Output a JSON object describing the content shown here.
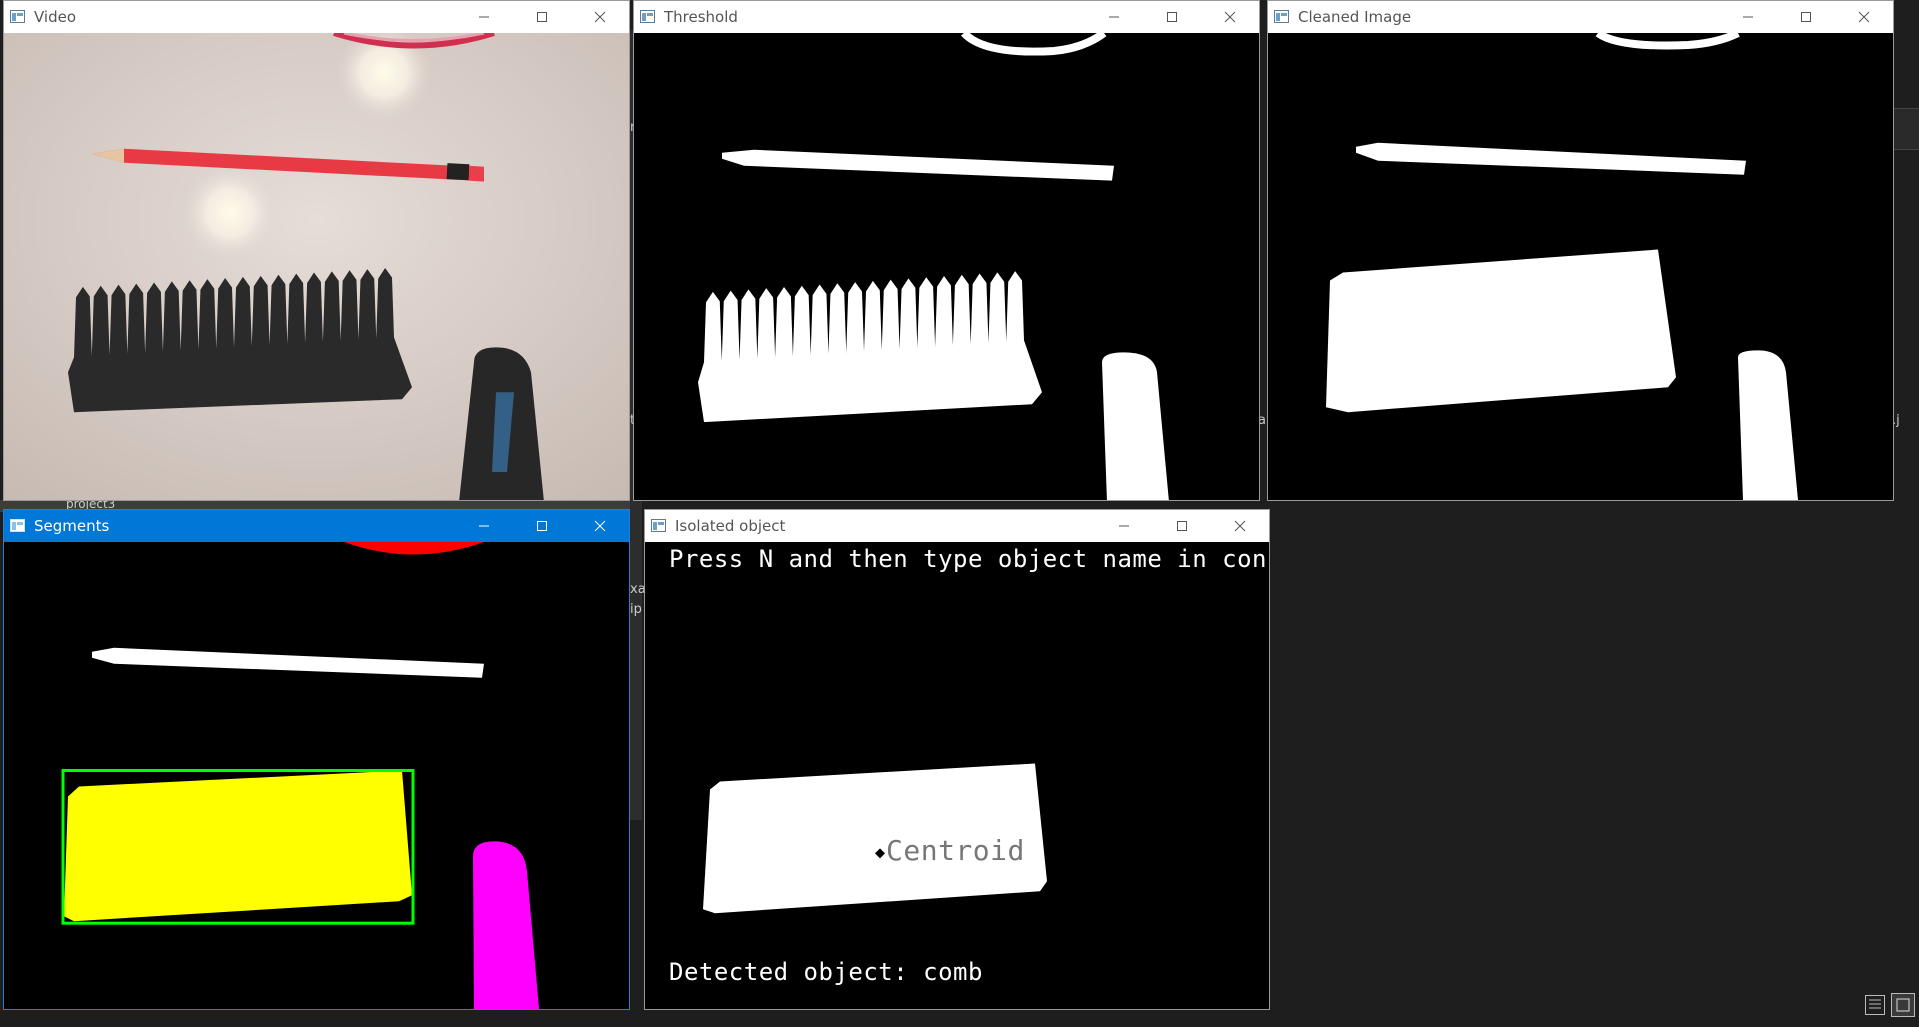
{
  "windows": {
    "video": {
      "title": "Video"
    },
    "threshold": {
      "title": "Threshold"
    },
    "cleaned": {
      "title": "Cleaned Image"
    },
    "segments": {
      "title": "Segments"
    },
    "isolated": {
      "title": "Isolated object",
      "instruction": "Press N and then type object name in console",
      "centroid_label": "Centroid",
      "detected_label": "Detected object: comb"
    }
  },
  "background": {
    "project_label": "project3",
    "fragment_1": "xa",
    "fragment_2": "ip",
    "fragment_3": "a",
    "fragment_4": "t",
    "fragment_5": "r",
    "fragment_6": ".j"
  },
  "colors": {
    "active_titlebar": "#0078d7",
    "segment_comb": "#ffff00",
    "segment_bbox": "#00ff00",
    "segment_case": "#ff00ff",
    "segment_top": "#ff0000"
  },
  "icons": [
    "app-icon",
    "minimize-icon",
    "maximize-icon",
    "close-icon",
    "list-view-icon",
    "tile-view-icon"
  ]
}
